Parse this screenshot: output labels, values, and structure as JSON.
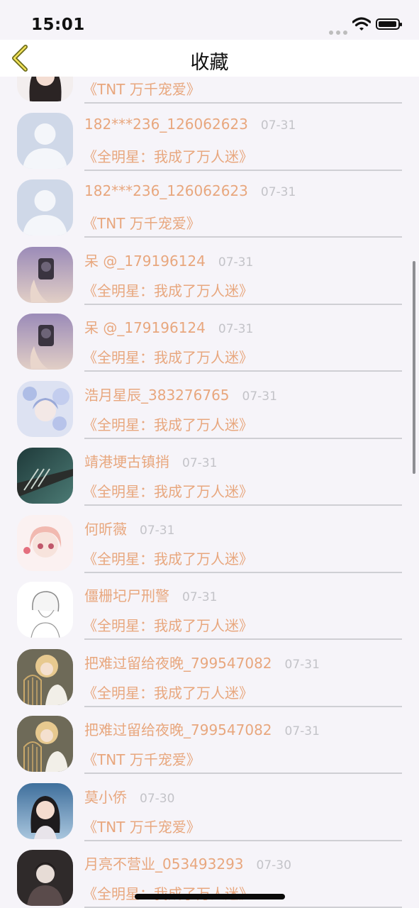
{
  "status_bar": {
    "time": "15:01"
  },
  "header": {
    "title": "收藏"
  },
  "colors": {
    "accent": "#e8a77e",
    "date": "#c3c3c8",
    "background": "#f6f4f9"
  },
  "favorites": [
    {
      "user": "",
      "date": "",
      "book": "《TNT 万千宠爱》",
      "avatar": "avatar-girl-dark-hair"
    },
    {
      "user": "182***236_126062623",
      "date": "07-31",
      "book": "《全明星：我成了万人迷》",
      "avatar": "default-avatar-icon"
    },
    {
      "user": "182***236_126062623",
      "date": "07-31",
      "book": "《TNT 万千宠爱》",
      "avatar": "default-avatar-icon"
    },
    {
      "user": "呆 @_179196124",
      "date": "07-31",
      "book": "《全明星：我成了万人迷》",
      "avatar": "avatar-camera-purple"
    },
    {
      "user": "呆 @_179196124",
      "date": "07-31",
      "book": "《全明星：我成了万人迷》",
      "avatar": "avatar-camera-purple"
    },
    {
      "user": "浩月星辰_383276765",
      "date": "07-31",
      "book": "《全明星：我成了万人迷》",
      "avatar": "avatar-anime-blue-flowers"
    },
    {
      "user": "靖港埂古镇捎",
      "date": "07-31",
      "book": "《全明星：我成了万人迷》",
      "avatar": "avatar-railway-teal"
    },
    {
      "user": "何昕薇",
      "date": "07-31",
      "book": "《全明星：我成了万人迷》",
      "avatar": "avatar-anime-pink-girl"
    },
    {
      "user": "僵栅圮尸刑警",
      "date": "07-31",
      "book": "《全明星：我成了万人迷》",
      "avatar": "avatar-anime-sketch-boy"
    },
    {
      "user": "把难过留给夜晚_799547082",
      "date": "07-31",
      "book": "《全明星：我成了万人迷》",
      "avatar": "avatar-anime-birdcage"
    },
    {
      "user": "把难过留给夜晚_799547082",
      "date": "07-31",
      "book": "《TNT 万千宠爱》",
      "avatar": "avatar-anime-birdcage"
    },
    {
      "user": "莫小侨",
      "date": "07-30",
      "book": "《TNT 万千宠爱》",
      "avatar": "avatar-woman-portrait"
    },
    {
      "user": "月亮不营业_053493293",
      "date": "07-30",
      "book": "《全明星：我成了万人迷》",
      "avatar": "avatar-dark-figure"
    }
  ]
}
